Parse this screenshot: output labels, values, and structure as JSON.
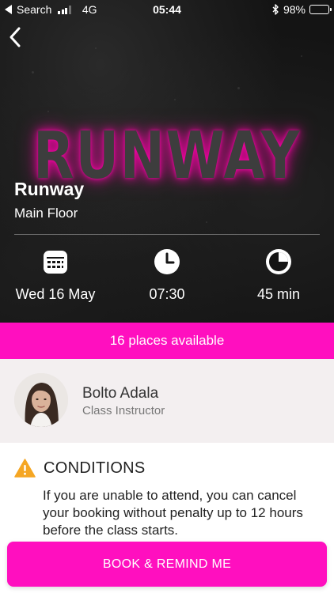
{
  "status_bar": {
    "back_app": "Search",
    "network": "4G",
    "time": "05:44",
    "battery": "98%",
    "battery_level": 0.98,
    "signal_bars": 3
  },
  "hero": {
    "logo_text": "RUNWAY",
    "class_name": "Runway",
    "location": "Main Floor",
    "date": "Wed 16 May",
    "time": "07:30",
    "duration": "45 min"
  },
  "availability": {
    "label": "16 places available"
  },
  "instructor": {
    "name": "Bolto Adala",
    "role": "Class Instructor"
  },
  "conditions": {
    "title": "CONDITIONS",
    "text": "If you are unable to attend, you can cancel your booking without penalty up to 12 hours before the class starts."
  },
  "cta": {
    "label": "BOOK & REMIND ME"
  },
  "colors": {
    "accent": "#ff0fbf",
    "hero_bg": "#141414",
    "warning": "#f5a623"
  },
  "icons": {
    "back": "chevron-left-icon",
    "date": "calendar-icon",
    "time": "clock-icon",
    "duration": "pie-timer-icon",
    "warning": "warning-triangle-icon"
  }
}
